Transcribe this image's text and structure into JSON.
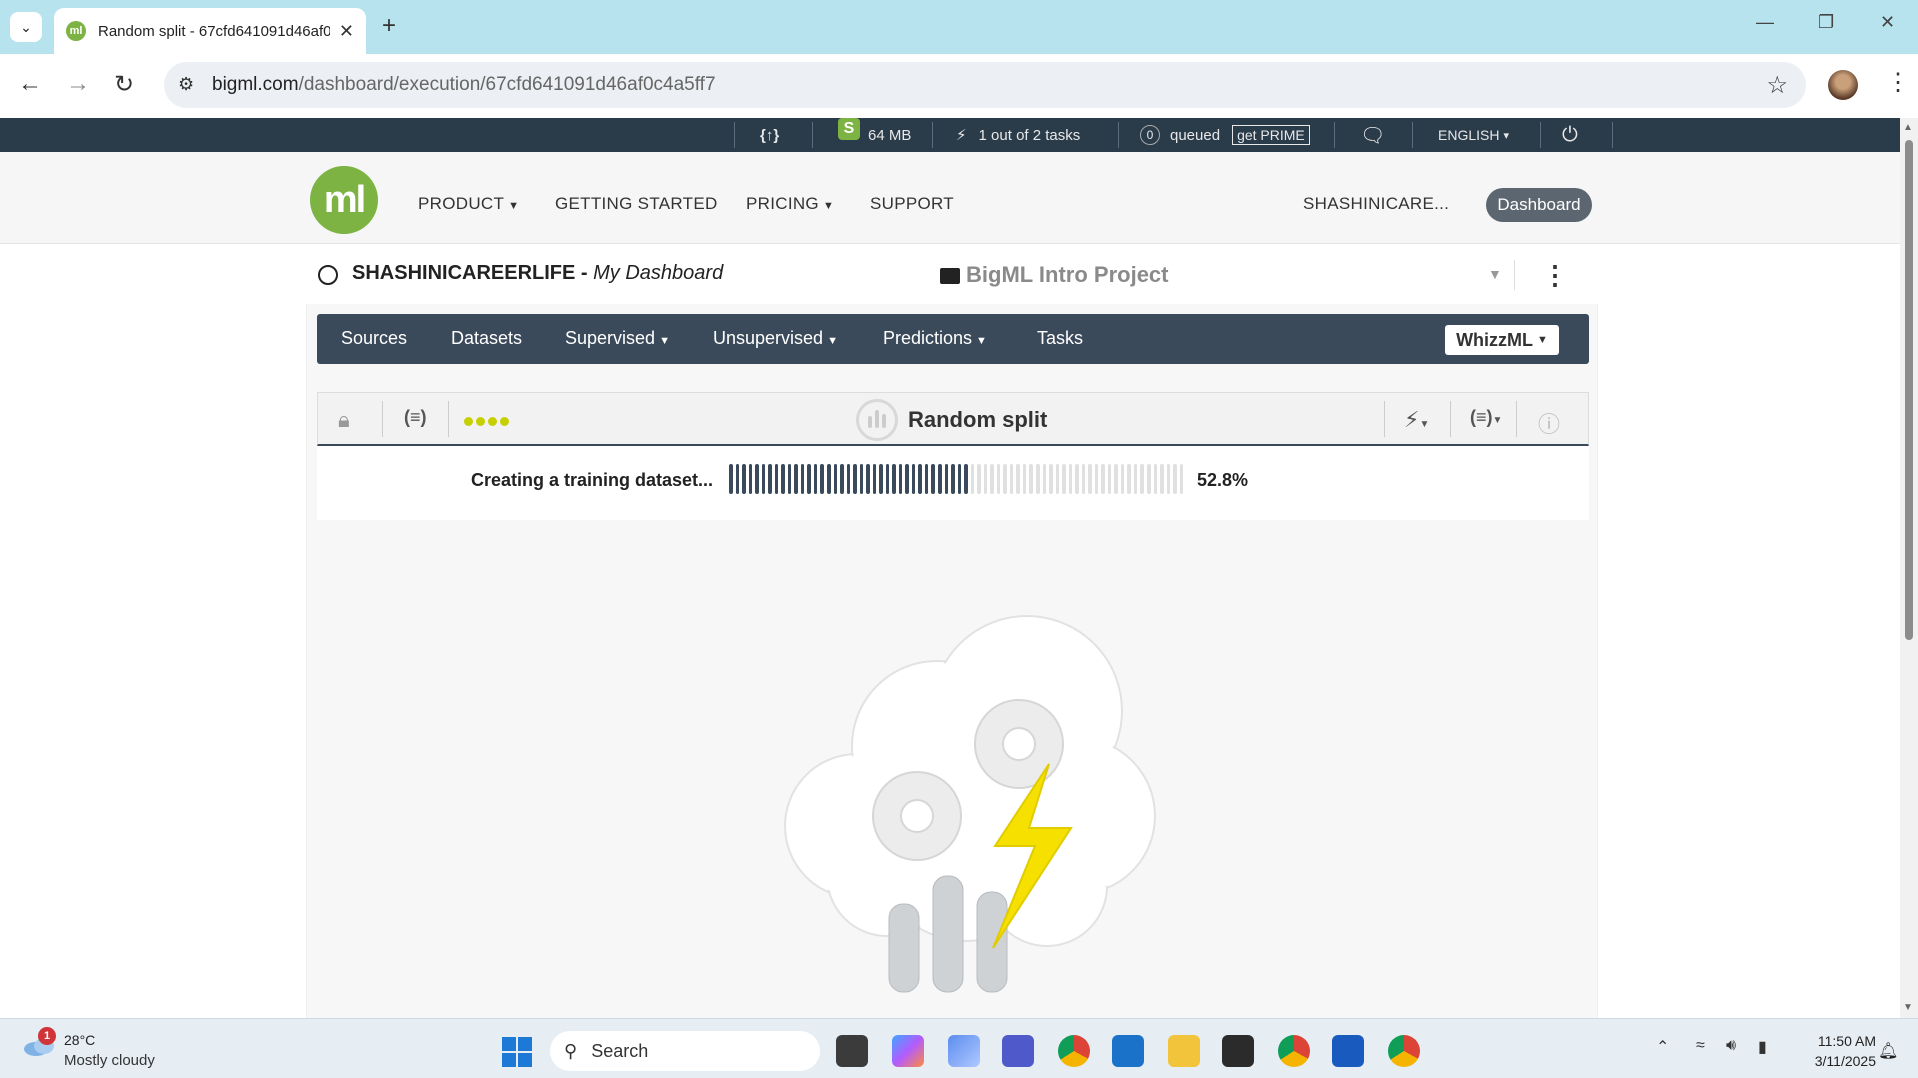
{
  "browser": {
    "tab_title": "Random split - 67cfd641091d46af0c4a5ff7",
    "url_host": "bigml.com",
    "url_path": "/dashboard/execution/67cfd641091d46af0c4a5ff7"
  },
  "statusbar": {
    "storage": "64 MB",
    "tasks": "1 out of 2 tasks",
    "queued_count": "0",
    "queued_label": "queued",
    "prime_label": "get PRIME",
    "language": "ENGLISH"
  },
  "header": {
    "logo_text": "ml",
    "menu": [
      "PRODUCT",
      "GETTING STARTED",
      "PRICING",
      "SUPPORT"
    ],
    "user_short": "SHASHINICARE...",
    "dashboard_button": "Dashboard"
  },
  "dashboard": {
    "user": "SHASHINICAREERLIFE",
    "subtitle": "My Dashboard",
    "project": "BigML Intro Project"
  },
  "resource_nav": {
    "items": [
      "Sources",
      "Datasets",
      "Supervised",
      "Unsupervised",
      "Predictions",
      "Tasks"
    ],
    "whizzml": "WhizzML"
  },
  "execution": {
    "title": "Random split",
    "progress_label": "Creating a training dataset...",
    "progress_fraction": 0.528,
    "progress_text": "52.8%"
  },
  "taskbar": {
    "temperature": "28°C",
    "condition": "Mostly cloudy",
    "weather_badge": "1",
    "search_placeholder": "Search",
    "time": "11:50 AM",
    "date": "3/11/2025"
  },
  "colors": {
    "brand_green": "#7cb342",
    "nav_dark": "#3a4a5a",
    "status_bar": "#2a3b4a",
    "bolt_yellow": "#f5e000"
  }
}
